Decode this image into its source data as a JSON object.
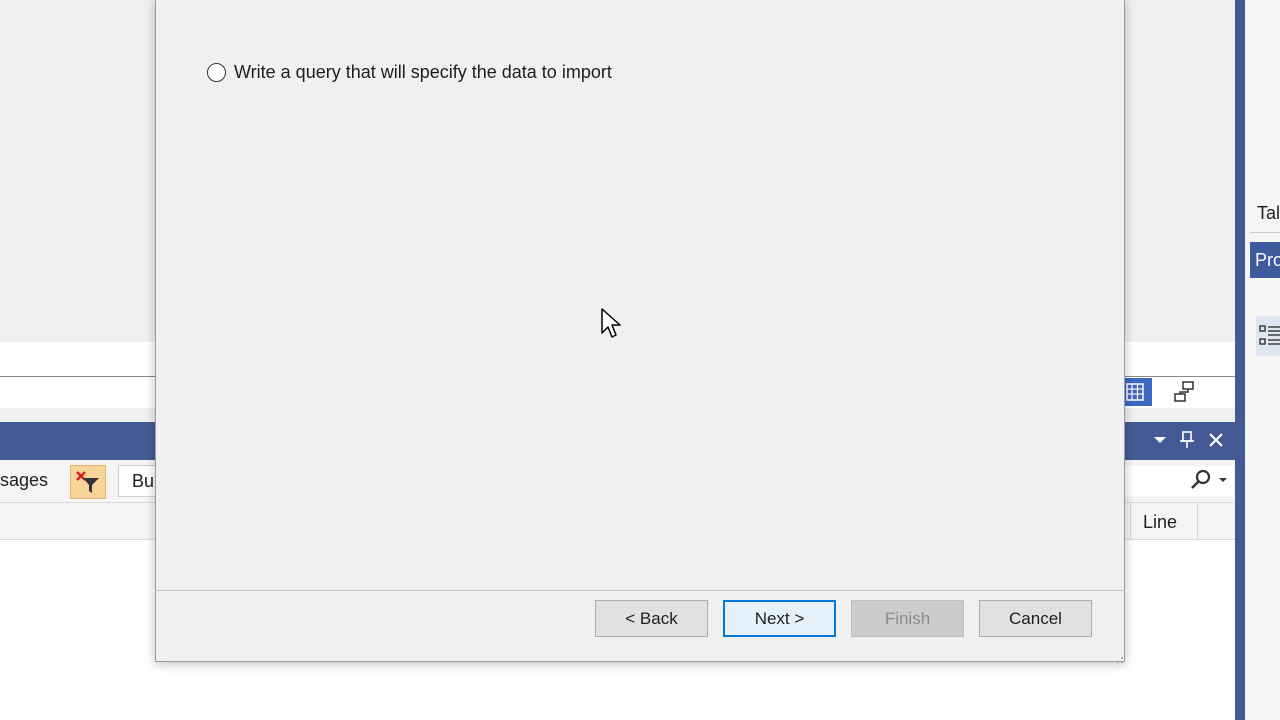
{
  "dialog": {
    "option_label": "Write a query that will specify the data to import",
    "buttons": {
      "back": "< Back",
      "next": "Next >",
      "finish": "Finish",
      "cancel": "Cancel"
    }
  },
  "ide": {
    "messages_tab_partial": "sages",
    "build_dropdown_partial": "Bu",
    "line_column_header": "Line",
    "right_tab_top_partial": "Tal",
    "right_tab_active_partial": "Pro"
  },
  "colors": {
    "tool_title": "#435a95",
    "accent": "#0078d7"
  }
}
